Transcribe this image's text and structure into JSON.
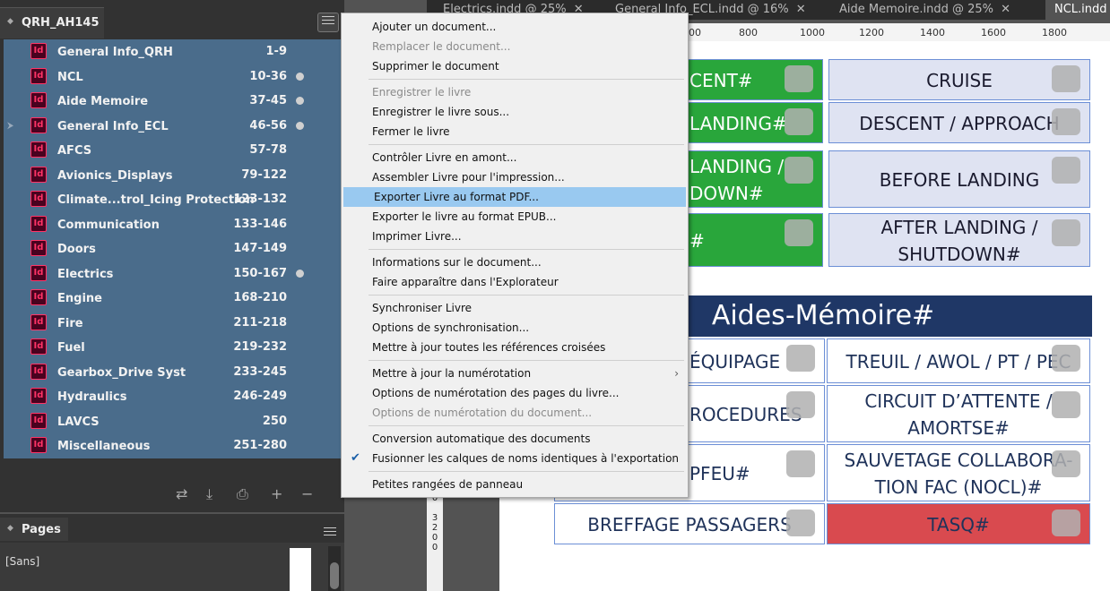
{
  "book_panel": {
    "title": "QRH_AH145",
    "documents": [
      {
        "name": "General Info_QRH",
        "pages": "1-9",
        "modified": false,
        "linked": false
      },
      {
        "name": "NCL",
        "pages": "10-36",
        "modified": true,
        "linked": false
      },
      {
        "name": "Aide Memoire",
        "pages": "37-45",
        "modified": true,
        "linked": false
      },
      {
        "name": "General Info_ECL",
        "pages": "46-56",
        "modified": true,
        "linked": true
      },
      {
        "name": "AFCS",
        "pages": "57-78",
        "modified": false,
        "linked": false
      },
      {
        "name": "Avionics_Displays",
        "pages": "79-122",
        "modified": false,
        "linked": false
      },
      {
        "name": "Climate...trol_Icing Protection",
        "pages": "123-132",
        "modified": false,
        "linked": false
      },
      {
        "name": "Communication",
        "pages": "133-146",
        "modified": false,
        "linked": false
      },
      {
        "name": "Doors",
        "pages": "147-149",
        "modified": false,
        "linked": false
      },
      {
        "name": "Electrics",
        "pages": "150-167",
        "modified": true,
        "linked": false
      },
      {
        "name": "Engine",
        "pages": "168-210",
        "modified": false,
        "linked": false
      },
      {
        "name": "Fire",
        "pages": "211-218",
        "modified": false,
        "linked": false
      },
      {
        "name": "Fuel",
        "pages": "219-232",
        "modified": false,
        "linked": false
      },
      {
        "name": "Gearbox_Drive Syst",
        "pages": "233-245",
        "modified": false,
        "linked": false
      },
      {
        "name": "Hydraulics",
        "pages": "246-249",
        "modified": false,
        "linked": false
      },
      {
        "name": "LAVCS",
        "pages": "250",
        "modified": false,
        "linked": false
      },
      {
        "name": "Miscellaneous",
        "pages": "251-280",
        "modified": false,
        "linked": false
      }
    ],
    "icon_label": "Id",
    "footer_icons": [
      "sync-icon",
      "add-document-icon",
      "print-icon",
      "plus-icon",
      "minus-icon"
    ]
  },
  "pages_panel": {
    "title": "Pages",
    "master_label": "[Sans]"
  },
  "document_tabs": [
    {
      "label": "Electrics.indd @ 25%",
      "active": false
    },
    {
      "label": "General Info_ECL.indd @ 16%",
      "active": false
    },
    {
      "label": "Aide Memoire.indd @ 25%",
      "active": false
    },
    {
      "label": "NCL.indd",
      "active": true
    }
  ],
  "ruler": {
    "ticks": [
      "00",
      "800",
      "1000",
      "1200",
      "1400",
      "1600",
      "1800"
    ],
    "vertical": "0\n0\n\n3\n2\n0\n0"
  },
  "canvas": {
    "left_column": [
      "CENT#",
      "LANDING#",
      "LANDING /\nDOWN#",
      "#"
    ],
    "right_column": [
      "CRUISE",
      "DESCENT / APPROACH",
      "BEFORE LANDING",
      "AFTER LANDING /\nSHUTDOWN#"
    ],
    "aides_title": "Aides-Mémoire#",
    "aides_left": [
      "ÉQUIPAGE",
      "ROCEDURES",
      "PFEU#",
      "BREFFAGE PASSAGERS"
    ],
    "aides_right": [
      "TREUIL / AWOL / PT / PEC",
      "CIRCUIT D’ATTENTE /\nAMORTSE#",
      "SAUVETAGE COLLABORA-\nTION FAC (NOCL)#",
      "TASQ#"
    ]
  },
  "context_menu": {
    "groups": [
      [
        {
          "label": "Ajouter un document...",
          "disabled": false
        },
        {
          "label": "Remplacer le document...",
          "disabled": true
        },
        {
          "label": "Supprimer le document",
          "disabled": false
        }
      ],
      [
        {
          "label": "Enregistrer le livre",
          "disabled": true
        },
        {
          "label": "Enregistrer le livre sous...",
          "disabled": false
        },
        {
          "label": "Fermer le livre",
          "disabled": false
        }
      ],
      [
        {
          "label": "Contrôler Livre en amont...",
          "disabled": false
        },
        {
          "label": "Assembler Livre pour l'impression...",
          "disabled": false
        },
        {
          "label": "Exporter Livre au format PDF...",
          "disabled": false,
          "highlighted": true
        },
        {
          "label": "Exporter le livre au format EPUB...",
          "disabled": false
        },
        {
          "label": "Imprimer Livre...",
          "disabled": false
        }
      ],
      [
        {
          "label": "Informations sur le document...",
          "disabled": false
        },
        {
          "label": "Faire apparaître dans l'Explorateur",
          "disabled": false
        }
      ],
      [
        {
          "label": "Synchroniser Livre",
          "disabled": false
        },
        {
          "label": "Options de synchronisation...",
          "disabled": false
        },
        {
          "label": "Mettre à jour toutes les références croisées",
          "disabled": false
        }
      ],
      [
        {
          "label": "Mettre à jour la numérotation",
          "disabled": false,
          "submenu": true
        },
        {
          "label": "Options de numérotation des pages du livre...",
          "disabled": false
        },
        {
          "label": "Options de numérotation du document...",
          "disabled": true
        }
      ],
      [
        {
          "label": "Conversion automatique des documents",
          "disabled": false
        },
        {
          "label": "Fusionner les calques de noms identiques à l'exportation",
          "disabled": false,
          "checked": true
        }
      ],
      [
        {
          "label": "Petites rangées de panneau",
          "disabled": false
        }
      ]
    ]
  },
  "colors": {
    "book_list_bg": "#4a6c8b",
    "menu_highlight": "#99c9f0",
    "indesign_icon": "#ff3366",
    "green_cell": "#29a63b",
    "aides_header": "#1f3766",
    "tasq_red": "#d94a4f"
  }
}
